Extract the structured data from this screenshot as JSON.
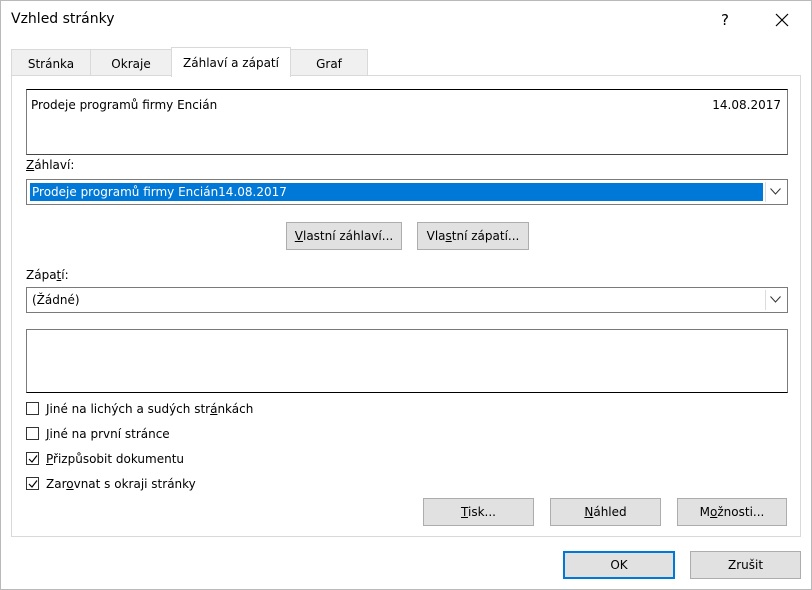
{
  "window": {
    "title": "Vzhled stránky",
    "help_label": "?"
  },
  "tabs": [
    {
      "label": "Stránka",
      "active": false
    },
    {
      "label": "Okraje",
      "active": false
    },
    {
      "label": "Záhlaví a zápatí",
      "active": true
    },
    {
      "label": "Graf",
      "active": false
    }
  ],
  "header_preview": {
    "left_text": "Prodeje programů firmy Encián",
    "right_text": "14.08.2017"
  },
  "header": {
    "label_underlined": "Z",
    "label_rest": "áhlaví:",
    "selected_value": "Prodeje programů firmy Encián14.08.2017"
  },
  "custom_buttons": {
    "custom_header_u": "V",
    "custom_header_rest": "lastní záhlaví...",
    "custom_footer_pre": "Vla",
    "custom_footer_u": "s",
    "custom_footer_rest": "tní zápatí..."
  },
  "footer": {
    "label_pre": "Zápa",
    "label_underlined": "t",
    "label_rest": "í:",
    "selected_value": "(Žádné)"
  },
  "options": [
    {
      "pre": "Jiné na lichých a sudých str",
      "u": "á",
      "rest": "nkách",
      "checked": false
    },
    {
      "pre": "",
      "u": "J",
      "rest": "iné na první stránce",
      "checked": false
    },
    {
      "pre": "",
      "u": "P",
      "rest": "řizpůsobit dokumentu",
      "checked": true
    },
    {
      "pre": "Zar",
      "u": "o",
      "rest": "vnat s okraji stránky",
      "checked": true
    }
  ],
  "panel_buttons": {
    "print_u": "T",
    "print_rest": "isk...",
    "preview_u": "N",
    "preview_rest": "áhled",
    "options_pre": "M",
    "options_u": "o",
    "options_rest": "žnosti..."
  },
  "dialog_buttons": {
    "ok": "OK",
    "cancel": "Zrušit"
  },
  "colors": {
    "selection": "#0078d7",
    "button_face": "#e1e1e1",
    "default_border": "#0078d7"
  }
}
